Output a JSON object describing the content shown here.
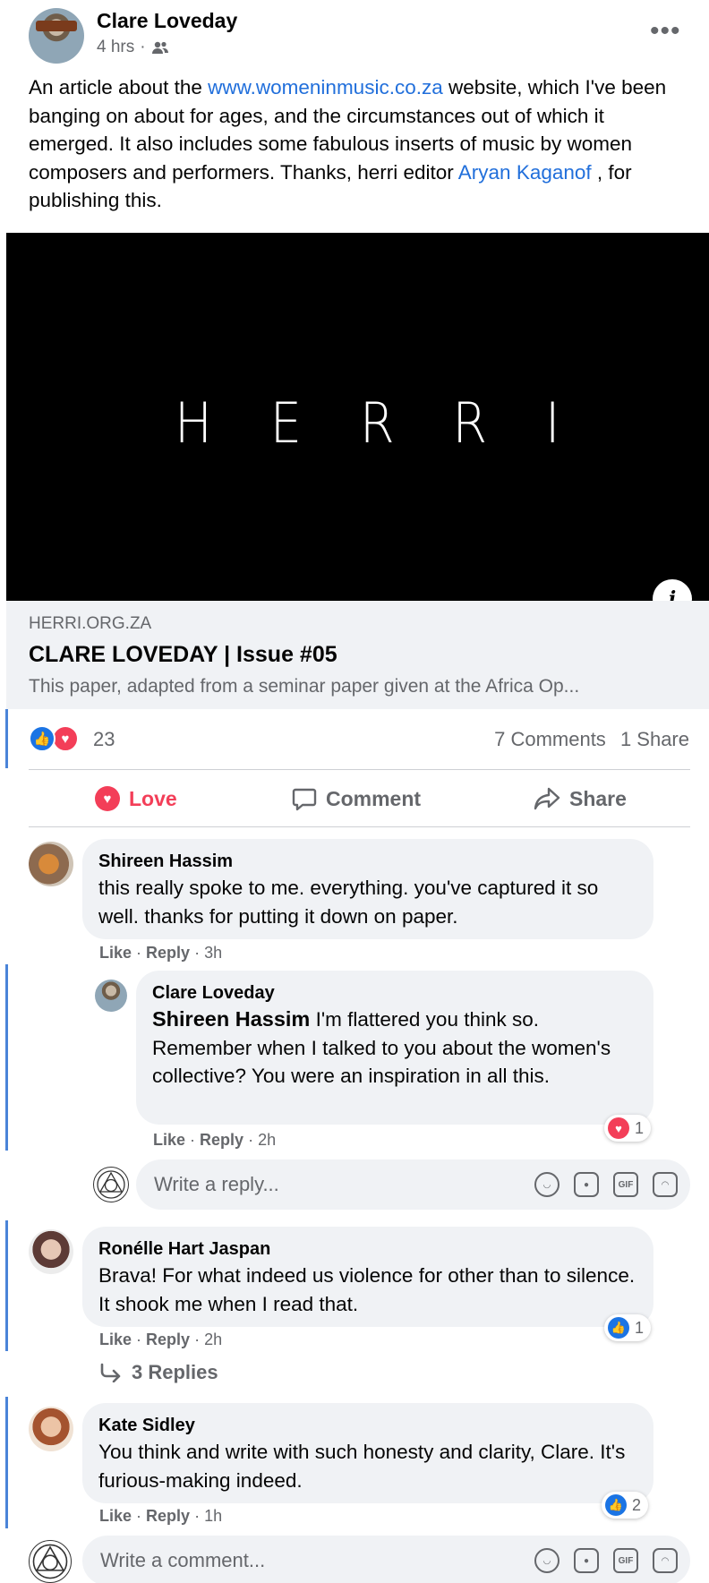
{
  "post": {
    "author": "Clare Loveday",
    "time": "4 hrs",
    "text_before": "An article about the ",
    "text_link": "www.womeninmusic.co.za",
    "text_middle": " website, which I've been banging on about for ages, and the circumstances out of which it emerged. It also includes some fabulous inserts of music by women composers and performers. Thanks, herri editor ",
    "text_mention": "Aryan Kaganof",
    "text_after": " , for publishing this."
  },
  "preview": {
    "logo": "HERRI",
    "domain": "HERRI.ORG.ZA",
    "title": "CLARE LOVEDAY | Issue #05",
    "description": "This paper, adapted from a seminar paper given at the Africa Op..."
  },
  "reactions": {
    "count": "23",
    "comments": "7 Comments",
    "shares": "1 Share",
    "icons": [
      "like-icon",
      "love-icon"
    ]
  },
  "actions": {
    "love": "Love",
    "comment": "Comment",
    "share": "Share"
  },
  "comments": [
    {
      "name": "Shireen Hassim",
      "text": "this really spoke to me. everything. you've captured it so well. thanks for putting it down on paper.",
      "like": "Like",
      "reply": "Reply",
      "time": "3h"
    },
    {
      "name": "Clare Loveday",
      "mention": "Shireen Hassim",
      "text": " I'm flattered you think so. Remember when I talked to you about the women's collective? You were an inspiration in all this.",
      "like": "Like",
      "reply": "Reply",
      "time": "2h",
      "reaction_count": "1"
    },
    {
      "name": "Ronélle Hart Jaspan",
      "text": "Brava! For what indeed us violence for other than to silence. It shook me when I read that.",
      "like": "Like",
      "reply": "Reply",
      "time": "2h",
      "reaction_count": "1",
      "replies": "3 Replies"
    },
    {
      "name": "Kate Sidley",
      "text": "You think and write with such honesty and clarity, Clare. It's furious-making indeed.",
      "like": "Like",
      "reply": "Reply",
      "time": "1h",
      "reaction_count": "2"
    }
  ],
  "reply_input": {
    "placeholder": "Write a reply..."
  },
  "comment_input": {
    "placeholder": "Write a comment..."
  },
  "colors": {
    "link": "#216fdb",
    "love": "#f33e58",
    "like": "#1b74e4"
  }
}
